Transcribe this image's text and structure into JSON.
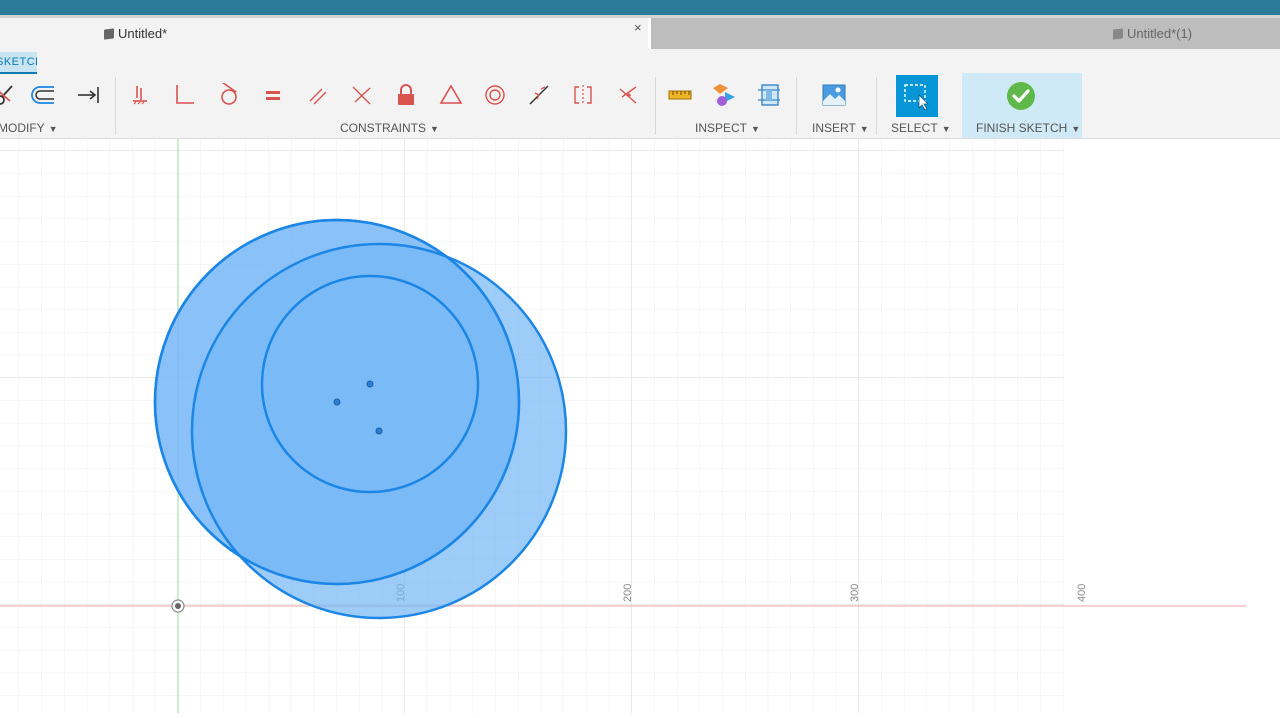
{
  "window": {
    "active_tab_title": "Untitled*",
    "inactive_tab_title": "Untitled*(1)",
    "close_glyph": "×"
  },
  "toolbar": {
    "mode_tab_label": "SKETCH",
    "groups": {
      "modify": "MODIFY",
      "constraints": "CONSTRAINTS",
      "inspect": "INSPECT",
      "insert": "INSERT",
      "select": "SELECT",
      "finish_sketch": "FINISH SKETCH"
    },
    "caret": "▼"
  },
  "canvas": {
    "axis_labels": [
      "100",
      "200",
      "300",
      "400"
    ]
  },
  "colors": {
    "accent": "#0696d7",
    "finish_green": "#5fb94a",
    "constraint_red": "#d9534f",
    "sketch_fill": "#74b6f7",
    "sketch_stroke": "#1b86e6",
    "x_axis": "#e8a6a6",
    "y_axis": "#9ed99e"
  },
  "icons": {
    "modify": [
      "trim-icon",
      "offset-icon",
      "extend-icon"
    ],
    "constraints": [
      "fix-icon",
      "perpendicular-icon",
      "tangent-icon",
      "equal-icon",
      "parallel-icon",
      "perpendicular-line-icon",
      "lock-icon",
      "triangle-icon",
      "concentric-icon",
      "midpoint-icon",
      "symmetry-icon",
      "collinear-icon"
    ],
    "inspect": [
      "measure-icon",
      "interference-icon",
      "section-analysis-icon"
    ],
    "insert": [
      "image-icon"
    ],
    "select": [
      "select-window-icon"
    ],
    "finish": [
      "checkmark-icon"
    ]
  }
}
